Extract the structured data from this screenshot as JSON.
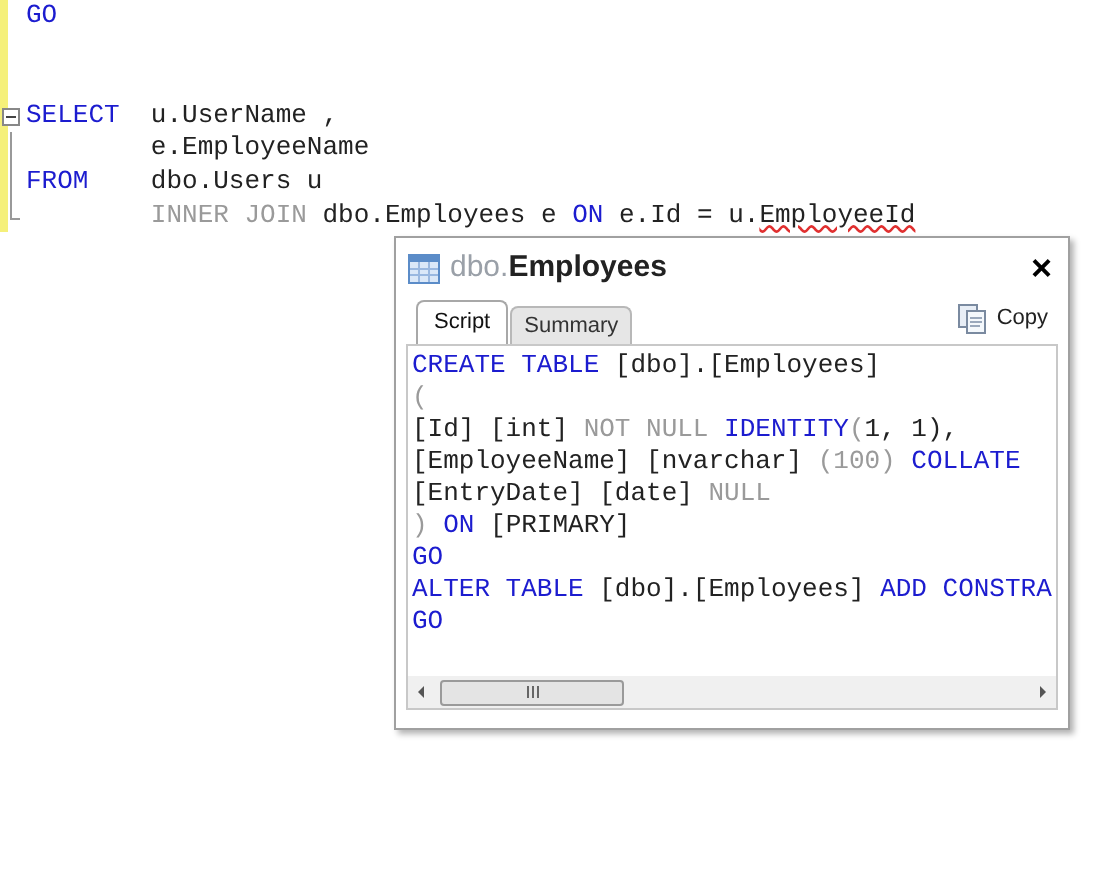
{
  "editor": {
    "lines": [
      {
        "kind": "code",
        "tokens": [
          {
            "text": "GO",
            "kind": "keyword"
          }
        ]
      },
      {
        "kind": "blank"
      },
      {
        "kind": "blank"
      },
      {
        "kind": "fold_start",
        "tokens": [
          {
            "text": "SELECT  ",
            "kind": "keyword"
          },
          {
            "text": "u.UserName ,",
            "kind": "plain"
          }
        ]
      },
      {
        "kind": "fold_inner",
        "tokens": [
          {
            "text": "        e.EmployeeName",
            "kind": "plain"
          }
        ]
      },
      {
        "kind": "fold_inner",
        "tokens": [
          {
            "text": "FROM    ",
            "kind": "keyword"
          },
          {
            "text": "dbo.Users u",
            "kind": "plain"
          }
        ]
      },
      {
        "kind": "fold_end",
        "tokens": [
          {
            "text": "        INNER JOIN ",
            "kind": "gray"
          },
          {
            "text": "dbo.Employees e ",
            "kind": "plain"
          },
          {
            "text": "ON ",
            "kind": "keyword"
          },
          {
            "text": "e.Id = u.",
            "kind": "plain"
          },
          {
            "text": "EmployeeId",
            "kind": "plain",
            "misspelled": true
          }
        ]
      }
    ]
  },
  "popup": {
    "schema": "dbo.",
    "name": "Employees",
    "close": "×",
    "tabs": [
      {
        "label": "Script",
        "selected": true
      },
      {
        "label": "Summary",
        "selected": false
      }
    ],
    "copy_button": "Copy",
    "script_lines": [
      [
        {
          "text": "CREATE TABLE ",
          "kind": "keyword"
        },
        {
          "text": "[dbo].[Employees]",
          "kind": "plain"
        }
      ],
      [
        {
          "text": "(",
          "kind": "gray"
        }
      ],
      [
        {
          "text": "[Id] [int] ",
          "kind": "plain"
        },
        {
          "text": "NOT NULL ",
          "kind": "gray"
        },
        {
          "text": "IDENTITY",
          "kind": "keyword"
        },
        {
          "text": "(",
          "kind": "gray"
        },
        {
          "text": "1, 1),",
          "kind": "plain"
        }
      ],
      [
        {
          "text": "[EmployeeName] [nvarchar] ",
          "kind": "plain"
        },
        {
          "text": "(100) ",
          "kind": "gray"
        },
        {
          "text": "COLLATE",
          "kind": "keyword"
        }
      ],
      [
        {
          "text": "[EntryDate] [date] ",
          "kind": "plain"
        },
        {
          "text": "NULL",
          "kind": "gray"
        }
      ],
      [
        {
          "text": ") ",
          "kind": "gray"
        },
        {
          "text": "ON ",
          "kind": "keyword"
        },
        {
          "text": "[PRIMARY]",
          "kind": "plain"
        }
      ],
      [
        {
          "text": "GO",
          "kind": "keyword"
        }
      ],
      [
        {
          "text": "ALTER TABLE ",
          "kind": "keyword"
        },
        {
          "text": "[dbo].[Employees] ",
          "kind": "plain"
        },
        {
          "text": "ADD CONSTRA",
          "kind": "keyword"
        }
      ],
      [
        {
          "text": "GO",
          "kind": "keyword"
        }
      ]
    ]
  }
}
